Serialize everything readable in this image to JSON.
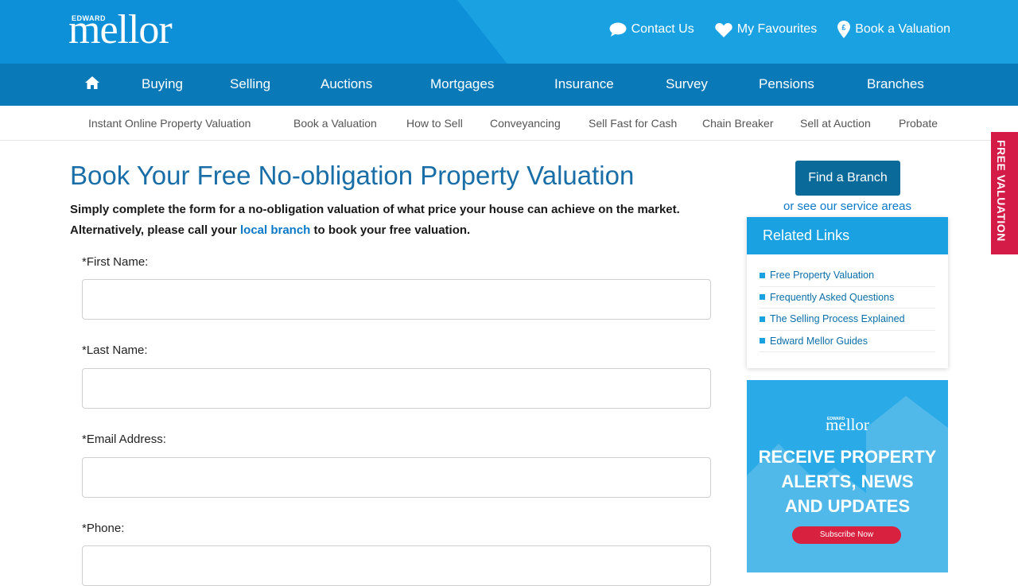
{
  "brand": {
    "logo_small": "EDWARD",
    "logo_big": "mellor"
  },
  "top_links": [
    {
      "label": "Contact Us",
      "icon": "speech-bubble-icon"
    },
    {
      "label": "My Favourites",
      "icon": "heart-icon"
    },
    {
      "label": "Book a Valuation",
      "icon": "pound-pin-icon"
    }
  ],
  "main_nav": {
    "home_icon": "home-icon",
    "items": [
      "Buying",
      "Selling",
      "Auctions",
      "Mortgages",
      "Insurance",
      "Survey",
      "Pensions",
      "Branches"
    ]
  },
  "sub_nav": [
    "Instant Online Property Valuation",
    "Book a Valuation",
    "How to Sell",
    "Conveyancing",
    "Sell Fast for Cash",
    "Chain Breaker",
    "Sell at Auction",
    "Probate"
  ],
  "page": {
    "title": "Book Your Free No-obligation Property Valuation",
    "intro_line1": "Simply complete the form for a no-obligation valuation of what price your house can achieve on the market.",
    "intro_line2_pre": "Alternatively, please call your ",
    "intro_link": "local branch",
    "intro_line2_post": " to book your free valuation."
  },
  "form": {
    "fields": [
      {
        "label": "*First Name:",
        "value": ""
      },
      {
        "label": "*Last Name:",
        "value": ""
      },
      {
        "label": "*Email Address:",
        "value": ""
      },
      {
        "label": "*Phone:",
        "value": ""
      }
    ]
  },
  "sidebar": {
    "find_branch": "Find a Branch",
    "service_areas": "or see our service areas",
    "related_title": "Related Links",
    "related_links": [
      "Free Property Valuation",
      "Frequently Asked Questions",
      "The Selling Process Explained",
      "Edward Mellor Guides"
    ],
    "promo": {
      "logo_small": "EDWARD",
      "logo_big": "mellor",
      "line1": "RECEIVE PROPERTY",
      "line2": "ALERTS, NEWS",
      "line3": "AND UPDATES",
      "button": "Subscribe Now"
    }
  },
  "side_tab": "FREE VALUATION",
  "colors": {
    "header_blue": "#0e90d8",
    "nav_blue": "#0a79b8",
    "title_blue": "#1a6ea8",
    "accent_red": "#d41a46"
  }
}
